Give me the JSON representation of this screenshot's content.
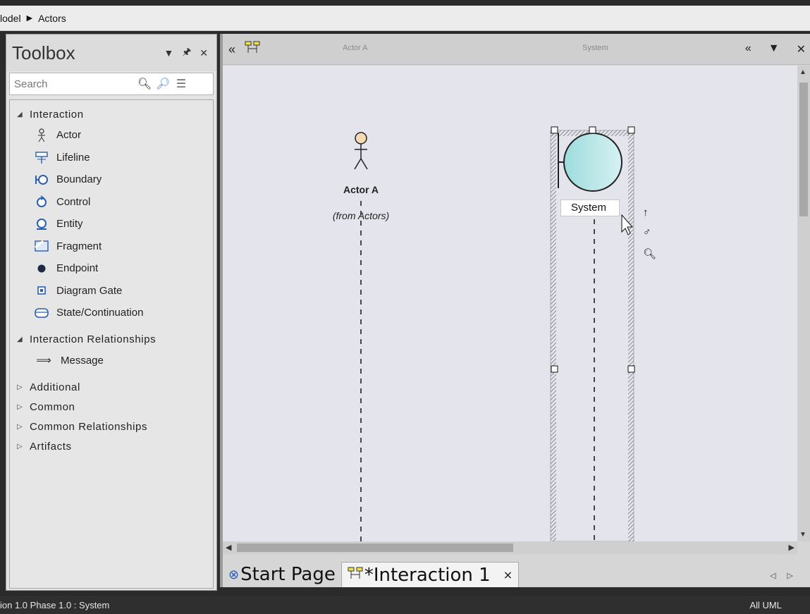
{
  "breadcrumb": {
    "part1": "lodel",
    "sep": "▶",
    "part2": "Actors"
  },
  "toolbox": {
    "title": "Toolbox",
    "search_placeholder": "Search",
    "groups": [
      {
        "label": "Interaction",
        "expanded": true,
        "items": [
          "Actor",
          "Lifeline",
          "Boundary",
          "Control",
          "Entity",
          "Fragment",
          "Endpoint",
          "Diagram Gate",
          "State/Continuation"
        ]
      },
      {
        "label": "Interaction Relationships",
        "expanded": true,
        "items": [
          "Message"
        ]
      },
      {
        "label": "Additional",
        "expanded": false
      },
      {
        "label": "Common",
        "expanded": false
      },
      {
        "label": "Common Relationships",
        "expanded": false
      },
      {
        "label": "Artifacts",
        "expanded": false
      }
    ]
  },
  "diagram": {
    "header_actor": "Actor A",
    "header_system": "System",
    "actor_name": "Actor A",
    "actor_from": "(from Actors)",
    "system_name": "System"
  },
  "tabs": {
    "start_page": "Start Page",
    "interaction": "*Interaction 1",
    "close": "×"
  },
  "status": {
    "left": "ion 1.0 Phase 1.0   : System",
    "right": "All UML"
  },
  "colors": {
    "boundary_fill": "#a8e0e0",
    "canvas_bg": "#e3e4ec",
    "actor_head": "#f6d9b5"
  }
}
